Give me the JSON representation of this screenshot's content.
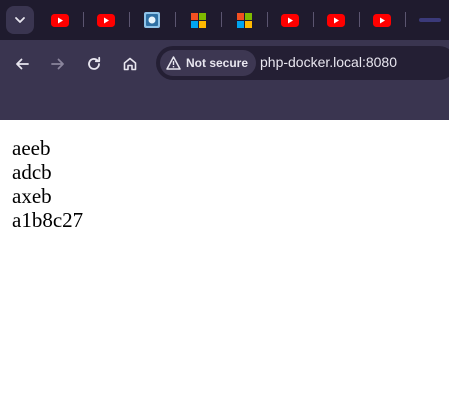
{
  "browser": {
    "tabs": [
      {
        "icon": "youtube-icon"
      },
      {
        "icon": "youtube-icon"
      },
      {
        "icon": "app-icon"
      },
      {
        "icon": "microsoft-icon"
      },
      {
        "icon": "microsoft-icon"
      },
      {
        "icon": "youtube-icon"
      },
      {
        "icon": "youtube-icon"
      },
      {
        "icon": "youtube-icon"
      }
    ],
    "security_label": "Not secure",
    "url": "php-docker.local:8080"
  },
  "page": {
    "lines": [
      "aeeb",
      "adcb",
      "axeb",
      "a1b8c27"
    ]
  },
  "colors": {
    "chrome": "#3a3550",
    "tab_strip": "#1f1b2e",
    "youtube_red": "#ff0000",
    "text_light": "#e8e6ef"
  }
}
